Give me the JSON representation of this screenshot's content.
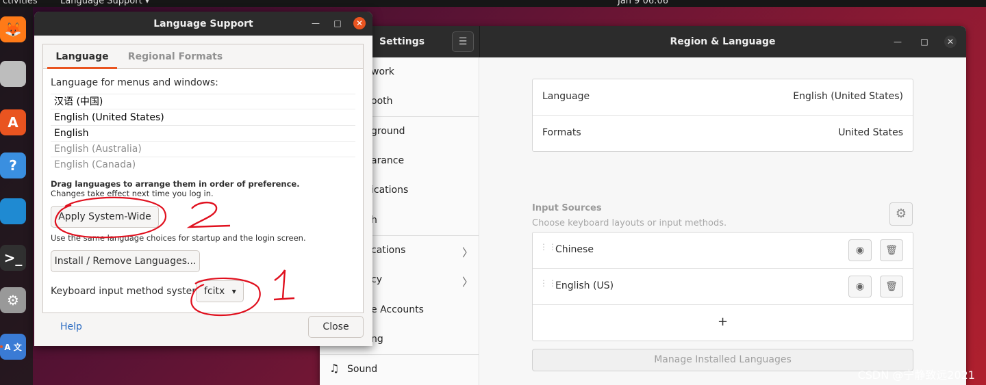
{
  "topbar": {
    "activities": "ctivities",
    "app_menu": "Language Support ▾",
    "clock": "Jan 9  06:06"
  },
  "dock": {
    "items": [
      {
        "name": "firefox",
        "glyph": "🦊",
        "color": "#ff7a18"
      },
      {
        "name": "files",
        "glyph": "",
        "color": "#bdbdbd"
      },
      {
        "name": "software",
        "glyph": "A",
        "color": "#e95420"
      },
      {
        "name": "help",
        "glyph": "?",
        "color": "#3a8fe0"
      },
      {
        "name": "vscode",
        "glyph": "",
        "color": "#1f8ad2"
      },
      {
        "name": "terminal",
        "glyph": ">_",
        "color": "#303030"
      },
      {
        "name": "settings",
        "glyph": "⚙",
        "color": "#999999"
      },
      {
        "name": "language",
        "glyph": "A 文",
        "color": "#3a7bd5"
      }
    ]
  },
  "settings": {
    "sidebar_title": "Settings",
    "menu_glyph": "☰",
    "title": "Region & Language",
    "controls": {
      "minimize": "—",
      "maximize": "□",
      "close": "✕"
    },
    "sidebar_items": [
      "work",
      "ooth",
      "ground",
      "arance",
      "ications",
      "h",
      "cations",
      "cy",
      "e Accounts",
      "ng",
      "Sound"
    ],
    "chevron": "〉",
    "sound_icon": "♫",
    "language_row": {
      "label": "Language",
      "value": "English (United States)"
    },
    "formats_row": {
      "label": "Formats",
      "value": "United States"
    },
    "input_sources": {
      "title": "Input Sources",
      "subtitle": "Choose keyboard layouts or input methods.",
      "gear_glyph": "⚙",
      "drag_glyph": "⋮⋮",
      "eye_glyph": "◉",
      "trash_glyph": "🗑",
      "items": [
        "Chinese",
        "English (US)"
      ],
      "add": "+"
    },
    "manage_button": "Manage Installed Languages"
  },
  "dialog": {
    "title": "Language Support",
    "controls": {
      "minimize": "—",
      "maximize": "□",
      "close": "✕"
    },
    "tabs": [
      "Language",
      "Regional Formats"
    ],
    "list_label": "Language for menus and windows:",
    "languages": [
      {
        "text": "汉语 (中国)",
        "dim": false
      },
      {
        "text": "English (United States)",
        "dim": false
      },
      {
        "text": "English",
        "dim": false
      },
      {
        "text": "English (Australia)",
        "dim": true
      },
      {
        "text": "English (Canada)",
        "dim": true
      }
    ],
    "drag_hint": "Drag languages to arrange them in order of preference.",
    "effect_hint": "Changes take effect next time you log in.",
    "apply_button": "Apply System-Wide",
    "apply_hint": "Use the same language choices for startup and the login screen.",
    "install_button": "Install / Remove Languages...",
    "im_label": "Keyboard input method system:",
    "im_value": "fcitx",
    "im_arrow": "▾",
    "help": "Help",
    "close": "Close"
  },
  "annotations": {
    "mark_1": "1",
    "mark_2": "2"
  },
  "watermark": "CSDN @宁静致远2021"
}
